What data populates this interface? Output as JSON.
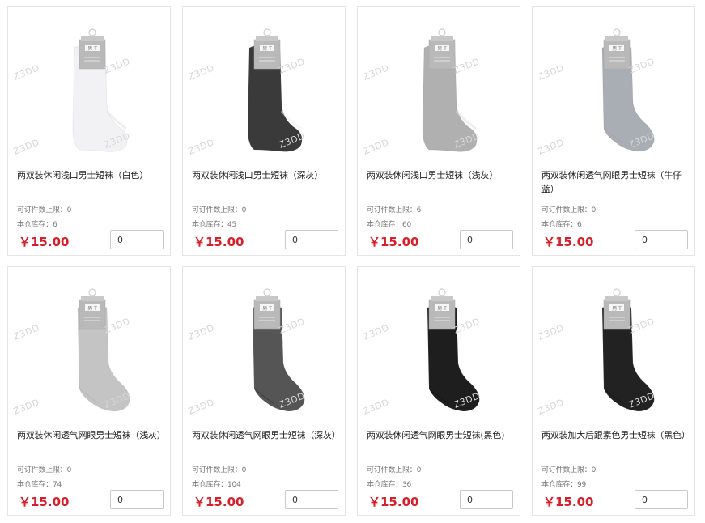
{
  "products": [
    {
      "name": "两双装休闲浅口男士短袜（白色）",
      "limit_label": "可订件数上限：",
      "limit": "0",
      "stock_label": "本仓库存：",
      "stock": "6",
      "price": "￥15.00",
      "qty": "0",
      "sock_color": "#f2f2f4",
      "sock_style": "no-show"
    },
    {
      "name": "两双装休闲浅口男士短袜（深灰）",
      "limit_label": "可订件数上限：",
      "limit": "0",
      "stock_label": "本仓库存：",
      "stock": "45",
      "price": "￥15.00",
      "qty": "0",
      "sock_color": "#3a3a3a",
      "sock_style": "no-show"
    },
    {
      "name": "两双装休闲浅口男士短袜（浅灰）",
      "limit_label": "可订件数上限：",
      "limit": "6",
      "stock_label": "本仓库存：",
      "stock": "60",
      "price": "￥15.00",
      "qty": "0",
      "sock_color": "#b0b0b0",
      "sock_style": "no-show"
    },
    {
      "name": "两双装休闲透气网眼男士短袜（牛仔蓝）",
      "limit_label": "可订件数上限：",
      "limit": "0",
      "stock_label": "本仓库存：",
      "stock": "6",
      "price": "￥15.00",
      "qty": "0",
      "sock_color": "#a9adb4",
      "sock_style": "ankle"
    },
    {
      "name": "两双装休闲透气网眼男士短袜（浅灰）",
      "limit_label": "可订件数上限：",
      "limit": "0",
      "stock_label": "本仓库存：",
      "stock": "74",
      "price": "￥15.00",
      "qty": "0",
      "sock_color": "#c4c4c4",
      "sock_style": "ankle"
    },
    {
      "name": "两双装休闲透气网眼男士短袜（深灰）",
      "limit_label": "可订件数上限：",
      "limit": "0",
      "stock_label": "本仓库存：",
      "stock": "104",
      "price": "￥15.00",
      "qty": "0",
      "sock_color": "#555555",
      "sock_style": "ankle"
    },
    {
      "name": "两双装休闲透气网眼男士短袜(黑色)",
      "limit_label": "可订件数上限：",
      "limit": "0",
      "stock_label": "本仓库存：",
      "stock": "36",
      "price": "￥15.00",
      "qty": "0",
      "sock_color": "#1e1e1e",
      "sock_style": "ankle"
    },
    {
      "name": "两双装加大后跟素色男士短袜（黑色）",
      "limit_label": "可订件数上限：",
      "limit": "0",
      "stock_label": "本仓库存：",
      "stock": "99",
      "price": "￥15.00",
      "qty": "0",
      "sock_color": "#222222",
      "sock_style": "ankle"
    }
  ],
  "watermark": "Z3DD",
  "tag_text": "男 T",
  "colors": {
    "price": "#d8202a",
    "border": "#e5e5e5"
  }
}
